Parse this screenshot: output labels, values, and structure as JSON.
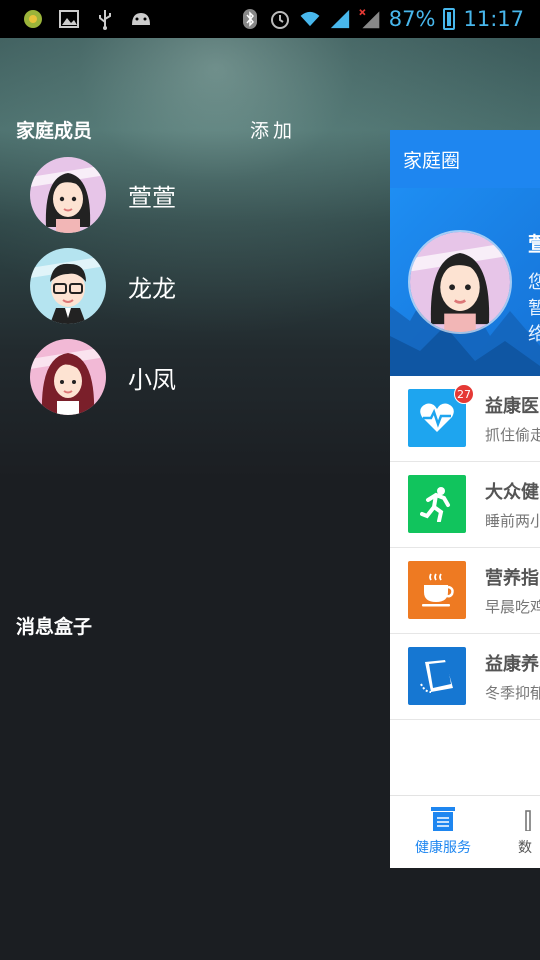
{
  "status_bar": {
    "battery": "87%",
    "time": "11:17",
    "left_icons": [
      "game-icon",
      "image-icon",
      "usb-icon",
      "android-icon"
    ],
    "right_icons": [
      "bluetooth-icon",
      "alarm-icon",
      "wifi-icon",
      "signal-icon",
      "signal-no-sim-icon",
      "battery-icon"
    ]
  },
  "drawer": {
    "family_title": "家庭成员",
    "add_label": "添加",
    "members": [
      {
        "name": "萱萱"
      },
      {
        "name": "龙龙"
      },
      {
        "name": "小凤"
      }
    ],
    "message_box_title": "消息盒子"
  },
  "panel": {
    "header_title": "家庭圈",
    "banner": {
      "name": "萱",
      "lines": [
        "您",
        "暂",
        "络"
      ]
    },
    "services": [
      {
        "title": "益康医",
        "desc": "抓住偷走",
        "badge": "27",
        "icon": "heart-pulse-icon",
        "color": "#1ea5ef"
      },
      {
        "title": "大众健",
        "desc": "睡前两小",
        "icon": "running-icon",
        "color": "#11c45d"
      },
      {
        "title": "营养指",
        "desc": "早晨吃鸡",
        "icon": "coffee-cup-icon",
        "color": "#ee7a22"
      },
      {
        "title": "益康养",
        "desc": "冬季抑郁",
        "icon": "book-icon",
        "color": "#1677d2"
      }
    ],
    "tabs": [
      {
        "label": "健康服务",
        "icon": "health-service-icon",
        "active": true
      },
      {
        "label": "数",
        "icon": "data-icon",
        "active": false
      }
    ]
  },
  "colors": {
    "accent": "#1e86f0",
    "status_text": "#48b7ec",
    "badge": "#e53935"
  }
}
